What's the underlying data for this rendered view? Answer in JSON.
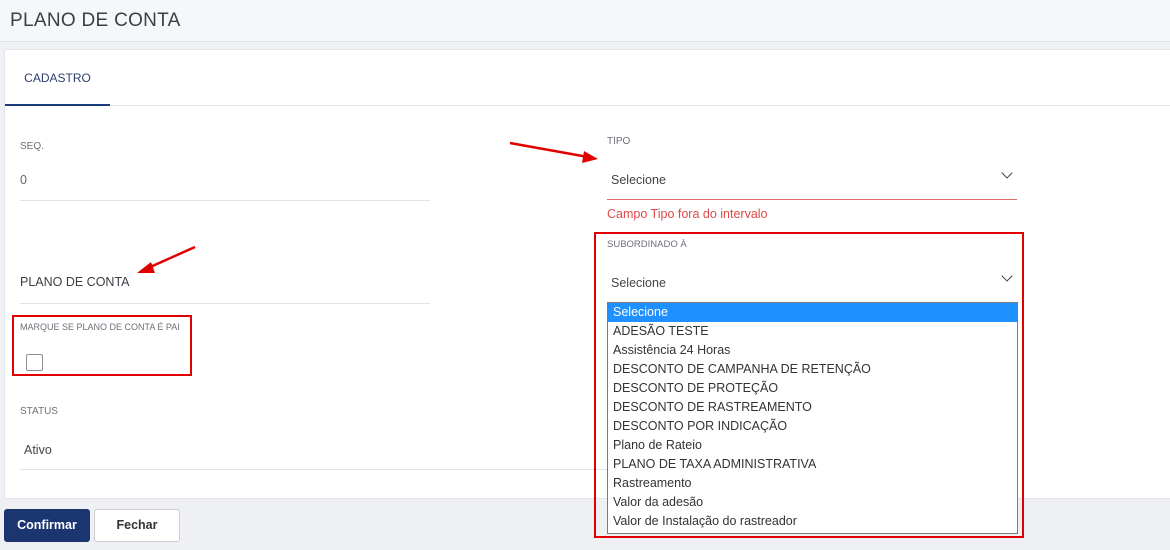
{
  "page": {
    "title": "PLANO DE CONTA"
  },
  "tabs": [
    {
      "label": "CADASTRO"
    }
  ],
  "form": {
    "seq": {
      "label": "SEQ.",
      "value": "0"
    },
    "plano_de_conta": {
      "placeholder": "PLANO DE CONTA"
    },
    "pai": {
      "label": "MARQUE SE PLANO DE CONTA É PAI",
      "checked": false
    },
    "status": {
      "label": "STATUS",
      "value": "Ativo"
    },
    "tipo": {
      "label": "TIPO",
      "value": "Selecione",
      "error": "Campo Tipo fora do intervalo"
    },
    "subordinado": {
      "label": "SUBORDINADO À",
      "value": "Selecione"
    }
  },
  "subordinado_options": [
    "Selecione",
    "ADESÃO TESTE",
    "Assistência 24 Horas",
    "DESCONTO DE CAMPANHA DE RETENÇÃO",
    "DESCONTO DE PROTEÇÃO",
    "DESCONTO DE RASTREAMENTO",
    "DESCONTO POR INDICAÇÃO",
    "Plano de Rateio",
    "PLANO DE TAXA ADMINISTRATIVA",
    "Rastreamento",
    "Valor da adesão",
    "Valor de Instalação do rastreador"
  ],
  "selected_option": "Selecione",
  "buttons": {
    "confirm": "Confirmar",
    "close": "Fechar"
  },
  "colors": {
    "primary": "#1a3570",
    "error": "#e04848",
    "highlight": "#1e90ff",
    "annotation": "#e00000"
  }
}
